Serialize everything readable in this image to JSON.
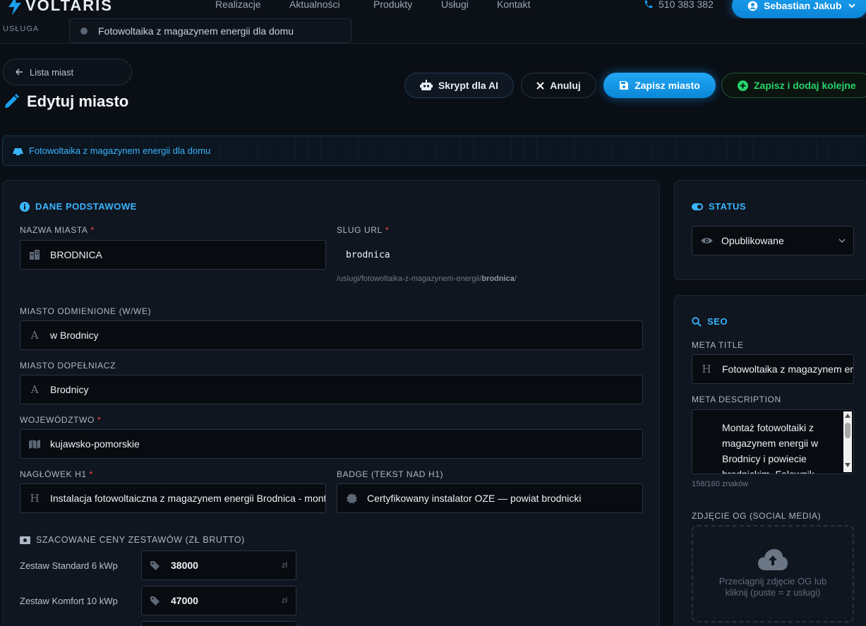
{
  "brand": {
    "name": "VOLTARIS"
  },
  "nav": {
    "links": [
      "Realizacje",
      "Aktualności",
      "Produkty",
      "Usługi",
      "Kontakt"
    ],
    "phone": "510 383 382",
    "user": "Sebastian Jakub"
  },
  "subbar": {
    "label": "USŁUGA",
    "selected": "Fotowoltaika z magazynem energii dla domu"
  },
  "back_link": "Lista miast",
  "page_title": "Edytuj miasto",
  "actions": {
    "ai": "Skrypt dla AI",
    "cancel": "Anuluj",
    "save": "Zapisz miasto",
    "save_add": "Zapisz i dodaj kolejne"
  },
  "service_banner": "Fotowoltaika z magazynem energii dla domu",
  "basic": {
    "title": "DANE PODSTAWOWE",
    "city_name": {
      "label": "NAZWA MIASTA",
      "required": "*",
      "value": "BRODNICA"
    },
    "slug": {
      "label": "SLUG URL",
      "required": "*",
      "value": "brodnica",
      "hint_prefix": "/uslugi/fotowoltaika-z-magazynem-energii/",
      "hint_slug": "brodnica",
      "hint_suffix": "/"
    },
    "city_locative": {
      "label": "MIASTO ODMIENIONE (W/WE)",
      "value": "w Brodnicy"
    },
    "city_genitive": {
      "label": "MIASTO DOPEŁNIACZ",
      "value": "Brodnicy"
    },
    "voivodeship": {
      "label": "WOJEWÓDZTWO",
      "required": "*",
      "value": "kujawsko-pomorskie"
    },
    "h1": {
      "label": "NAGŁÓWEK H1",
      "required": "*",
      "value": "Instalacja fotowoltaiczna z magazynem energii Brodnica - montaż"
    },
    "badge": {
      "label": "BADGE (TEKST NAD H1)",
      "value": "Certyfikowany instalator OZE — powiat brodnicki"
    }
  },
  "prices": {
    "title": "SZACOWANE CENY ZESTAWÓW (ZŁ BRUTTO)",
    "items": [
      {
        "label": "Zestaw Standard 6 kWp",
        "value": "38000",
        "unit": "zł"
      },
      {
        "label": "Zestaw Komfort 10 kWp",
        "value": "47000",
        "unit": "zł"
      }
    ]
  },
  "status": {
    "title": "STATUS",
    "value": "Opublikowane"
  },
  "seo": {
    "title": "SEO",
    "meta_title": {
      "label": "META TITLE",
      "value": "Fotowoltaika z magazynem energii Brodnica"
    },
    "meta_description": {
      "label": "META DESCRIPTION",
      "value": "Montaż fotowoltaiki z magazynem energii w Brodnicy i powiecie brodnickim. Falownik",
      "counter": "158/160 znaków"
    },
    "og": {
      "label": "ZDJĘCIE OG (SOCIAL MEDIA)",
      "text": "Przeciągnij zdjęcie OG lub kliknij (puste = z usługi)"
    }
  },
  "colors": {
    "accent": "#1aa0f0",
    "success": "#27d36a",
    "required": "#ff4d4d",
    "background": "#0a0e15"
  }
}
